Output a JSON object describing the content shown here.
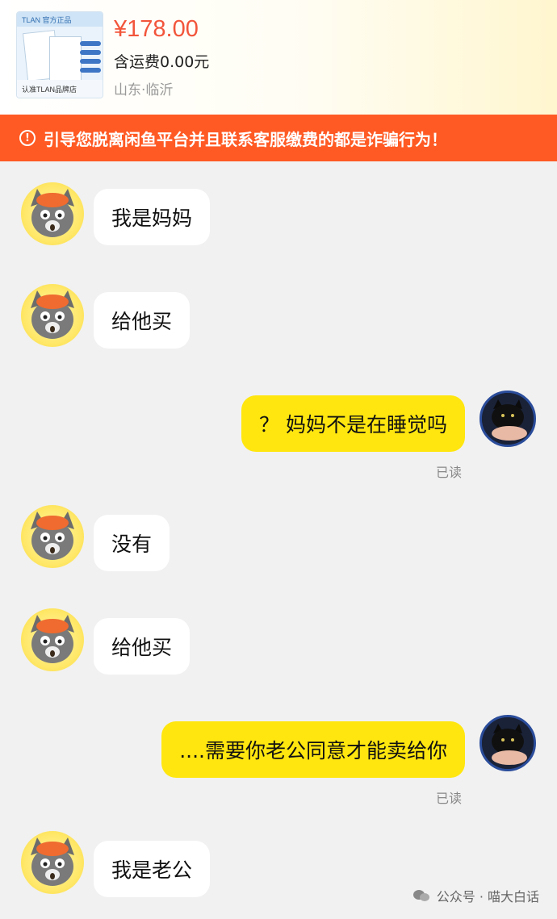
{
  "product": {
    "thumb_top": "TLAN 官方正品",
    "thumb_bottom": "认准TLAN品牌店",
    "price": "¥178.00",
    "shipping": "含运费0.00元",
    "location": "山东·临沂"
  },
  "warning": {
    "icon": "exclamation-circle-icon",
    "text": "引导您脱离闲鱼平台并且联系客服缴费的都是诈骗行为！"
  },
  "messages": [
    {
      "side": "left",
      "text": "我是妈妈"
    },
    {
      "side": "left",
      "text": "给他买"
    },
    {
      "side": "right",
      "text": "？ 妈妈不是在睡觉吗",
      "status": "已读"
    },
    {
      "side": "left",
      "text": "没有"
    },
    {
      "side": "left",
      "text": "给他买"
    },
    {
      "side": "right",
      "text": "....需要你老公同意才能卖给你",
      "status": "已读"
    },
    {
      "side": "left",
      "text": "我是老公"
    }
  ],
  "watermark": {
    "text": "公众号 · 喵大白话",
    "icon": "wechat-icon"
  },
  "colors": {
    "price": "#f2553b",
    "warning_bg": "#ff5a24",
    "my_bubble": "#ffe60f",
    "their_bubble": "#ffffff",
    "background": "#f1f1f1"
  }
}
